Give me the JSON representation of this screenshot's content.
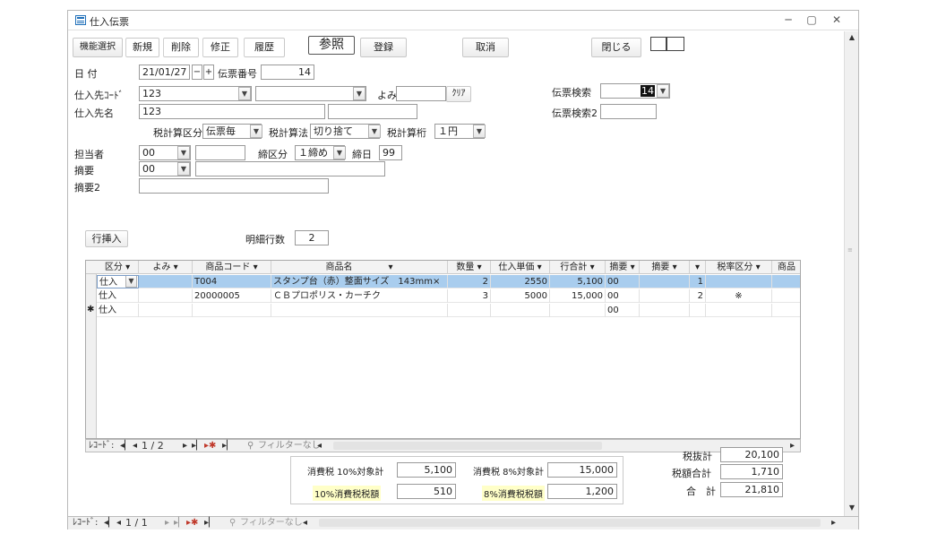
{
  "window": {
    "title": "仕入伝票",
    "controls": [
      "─",
      "▢",
      "✕"
    ]
  },
  "toolbar": {
    "func_select": "機能選択",
    "new": "新規",
    "delete": "削除",
    "edit": "修正",
    "history": "履歴",
    "view": "参照",
    "register": "登録",
    "cancel": "取消",
    "close": "閉じる"
  },
  "header": {
    "date_label": "日 付",
    "date_value": "21/01/27",
    "minus": "−",
    "plus": "+",
    "voucher_no_label": "伝票番号",
    "voucher_no_value": "14",
    "supplier_code_label": "仕入先ｺｰﾄﾞ",
    "supplier_code_value": "123",
    "yomi_label": "よみ",
    "clear_label": "ｸﾘｱ",
    "supplier_name_label": "仕入先名",
    "supplier_name_value": "123",
    "tax_calc_label": "税計算区分",
    "tax_calc_value": "伝票毎",
    "tax_method_label": "税計算法",
    "tax_method_value": "切り捨て",
    "tax_digit_label": "税計算桁",
    "tax_digit_value": "１円",
    "staff_label": "担当者",
    "staff_value": "00",
    "closing_type_label": "締区分",
    "closing_type_value": "１締め",
    "closing_day_label": "締日",
    "closing_day_value": "99",
    "memo_label": "摘要",
    "memo_value": "00",
    "memo2_label": "摘要2",
    "search_label": "伝票検索",
    "search_value": "14",
    "search2_label": "伝票検索2"
  },
  "detail": {
    "insert_row": "行挿入",
    "row_count_label": "明細行数",
    "row_count_value": "2",
    "columns": [
      "区分",
      "よみ",
      "商品コード",
      "商品名",
      "数量",
      "仕入単価",
      "行合計",
      "摘要",
      "摘要",
      "",
      "税率区分",
      "商品"
    ],
    "rows": [
      {
        "kubun": "仕入",
        "yomi": "",
        "code": "T004",
        "name": "スタンプ台（赤）整面サイズ　143mm×",
        "qty": "2",
        "price": "2550",
        "total": "5,100",
        "memo": "00",
        "memo2": "",
        "idx": "1",
        "tax": ""
      },
      {
        "kubun": "仕入",
        "yomi": "",
        "code": "20000005",
        "name": "ＣＢプロポリス・カーチク",
        "qty": "3",
        "price": "5000",
        "total": "15,000",
        "memo": "00",
        "memo2": "",
        "idx": "2",
        "tax": "※"
      },
      {
        "kubun": "仕入",
        "yomi": "",
        "code": "",
        "name": "",
        "qty": "",
        "price": "",
        "total": "",
        "memo": "00",
        "memo2": "",
        "idx": "",
        "tax": ""
      }
    ],
    "new_row_marker": "✱",
    "nav_label": "ﾚｺｰﾄﾞ:",
    "nav_position": "1 / 2",
    "filter": "フィルターなし"
  },
  "totals": {
    "tax10_base_label": "消費税 10%対象計",
    "tax10_base_value": "5,100",
    "tax8_base_label": "消費税 8%対象計",
    "tax8_base_value": "15,000",
    "tax10_label": "10%消費税税額",
    "tax10_value": "510",
    "tax8_label": "8%消費税税額",
    "tax8_value": "1,200",
    "subtotal_label": "税抜計",
    "subtotal_value": "20,100",
    "tax_total_label": "税額合計",
    "tax_total_value": "1,710",
    "grand_total_label": "合　計",
    "grand_total_value": "21,810"
  },
  "bottom_nav": {
    "nav_label": "ﾚｺｰﾄﾞ:",
    "nav_position": "1 / 1",
    "filter": "フィルターなし"
  },
  "colors": {
    "selected_row": "#a9cdee",
    "label_highlight": "#ffffc8"
  }
}
